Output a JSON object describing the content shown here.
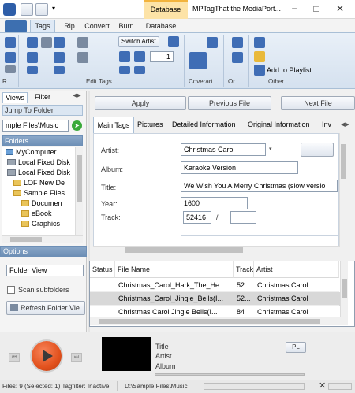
{
  "window": {
    "contextual_tab": "Database",
    "title": "MPTagThat the MediaPort...",
    "minimize": "−",
    "maximize": "□",
    "close": "✕"
  },
  "ribbon_tabs": [
    {
      "label": "Tags"
    },
    {
      "label": "Rip"
    },
    {
      "label": "Convert"
    },
    {
      "label": "Burn"
    },
    {
      "label": "Database"
    }
  ],
  "ribbon": {
    "switch_artist": "Switch Artist",
    "track_field": "1",
    "add_to_playlist": "Add to Playlist",
    "groups": {
      "r": "R...",
      "edit_tags": "Edit Tags",
      "coverart": "Coverart",
      "or": "Or...",
      "other": "Other"
    }
  },
  "left_panel": {
    "tabs": [
      "Views",
      "Filter"
    ],
    "jump_to_folder": "Jump To Folder",
    "folder_path": "mple Files\\Music",
    "folders_header": "Folders",
    "tree": [
      {
        "label": "MyComputer",
        "icon": "computer"
      },
      {
        "label": "Local Fixed Disk",
        "icon": "drive"
      },
      {
        "label": "Local Fixed Disk",
        "icon": "drive"
      },
      {
        "label": "LOF New De",
        "icon": "folder"
      },
      {
        "label": "Sample Files",
        "icon": "folder"
      },
      {
        "label": "Documen",
        "icon": "folder"
      },
      {
        "label": "eBook",
        "icon": "folder"
      },
      {
        "label": "Graphics",
        "icon": "folder"
      }
    ],
    "options_header": "Options",
    "view_mode": "Folder View",
    "scan_subfolders": "Scan subfolders",
    "refresh_button": "Refresh Folder Vie"
  },
  "tag_editor": {
    "apply": "Apply",
    "previous_file": "Previous File",
    "next_file": "Next File",
    "tabs": [
      "Main Tags",
      "Pictures",
      "Detailed Information",
      "Original Information",
      "Inv"
    ],
    "artist_label": "Artist:",
    "artist_value": "Christmas Carol",
    "album_label": "Album:",
    "album_value": "Karaoke Version",
    "title_label": "Title:",
    "title_value": "We Wish You A Merry Christmas (slow versio",
    "year_label": "Year:",
    "year_value": "1600",
    "track_label": "Track:",
    "track_value": "52416",
    "track_sep": "/",
    "track_total": ""
  },
  "file_grid": {
    "columns": [
      "Status",
      "File Name",
      "Track",
      "Artist"
    ],
    "rows": [
      {
        "status": "",
        "file": "Christmas_Carol_Hark_The_He...",
        "track": "52...",
        "artist": "Christmas Carol",
        "selected": false
      },
      {
        "status": "",
        "file": "Christmas_Carol_Jingle_Bells(I...",
        "track": "52...",
        "artist": "Christmas Carol",
        "selected": true
      },
      {
        "status": "",
        "file": "Christmas Carol Jingle Bells(I...",
        "track": "84",
        "artist": "Christmas Carol",
        "selected": false
      }
    ]
  },
  "player": {
    "title_label": "Title",
    "artist_label": "Artist",
    "album_label": "Album",
    "playlist_button": "PL"
  },
  "status": {
    "files": "Files: 9 (Selected: 1)  Tagfilter: Inactive",
    "path": "D:\\Sample Files\\Music"
  },
  "colors": {
    "accent": "#3d6fb0",
    "context_tab": "#fde3a7",
    "play_button": "#e2511d"
  }
}
